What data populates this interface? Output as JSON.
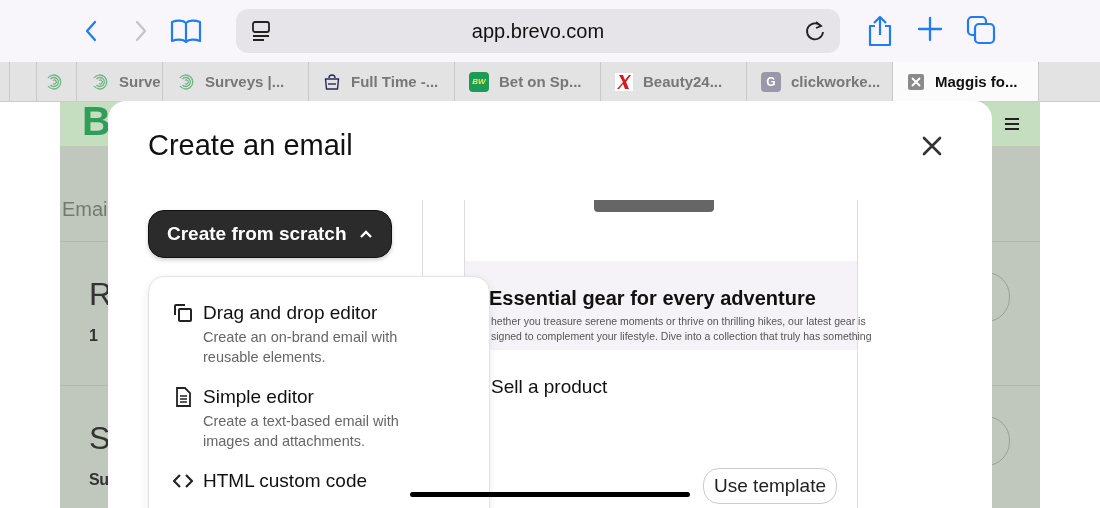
{
  "browser": {
    "nav_buttons": [
      {
        "kind": "back",
        "disabled": false
      },
      {
        "kind": "forward",
        "disabled": true
      }
    ],
    "address": "app.brevo.com",
    "tabs": [
      {
        "kind": "spiral",
        "selected": false
      },
      {
        "kind": "spiral",
        "label": "Surve",
        "selected": false
      },
      {
        "kind": "spiral",
        "label": "Surveys |...",
        "selected": false
      },
      {
        "kind": "bag",
        "label": "Full Time -...",
        "selected": false
      },
      {
        "kind": "badge",
        "favicon_text": "BW",
        "label": "Bet on Sp...",
        "selected": false
      },
      {
        "kind": "xmark",
        "label": "Beauty24...",
        "selected": false
      },
      {
        "kind": "letter",
        "favicon_text": "G",
        "label": "clickworke...",
        "selected": false
      },
      {
        "kind": "closebox",
        "label": "Maggis fo...",
        "selected": true
      }
    ]
  },
  "page": {
    "logo": "B",
    "section_label": "Emai",
    "rows": [
      {
        "title": "R",
        "subtitle": "1"
      },
      {
        "title": "S",
        "subtitle": "Su"
      }
    ]
  },
  "modal": {
    "title": "Create an email",
    "scratch_button": {
      "label": "Create from scratch",
      "expanded": true
    },
    "menu": [
      {
        "kind": "drag",
        "title": "Drag and drop editor",
        "description": "Create an on-brand email with reusable elements."
      },
      {
        "kind": "simple",
        "title": "Simple editor",
        "description": "Create a text-based email with images and attachments."
      },
      {
        "kind": "code",
        "title": "HTML custom code"
      }
    ],
    "preview": {
      "heading": "Essential gear for every adventure",
      "paragraph_lines": [
        "hether you treasure serene moments or thrive on thrilling hikes, our latest gear is",
        "signed to complement your lifestyle. Dive into a collection that truly has something"
      ],
      "template_name": "Sell a product",
      "use_button": "Use template"
    }
  }
}
